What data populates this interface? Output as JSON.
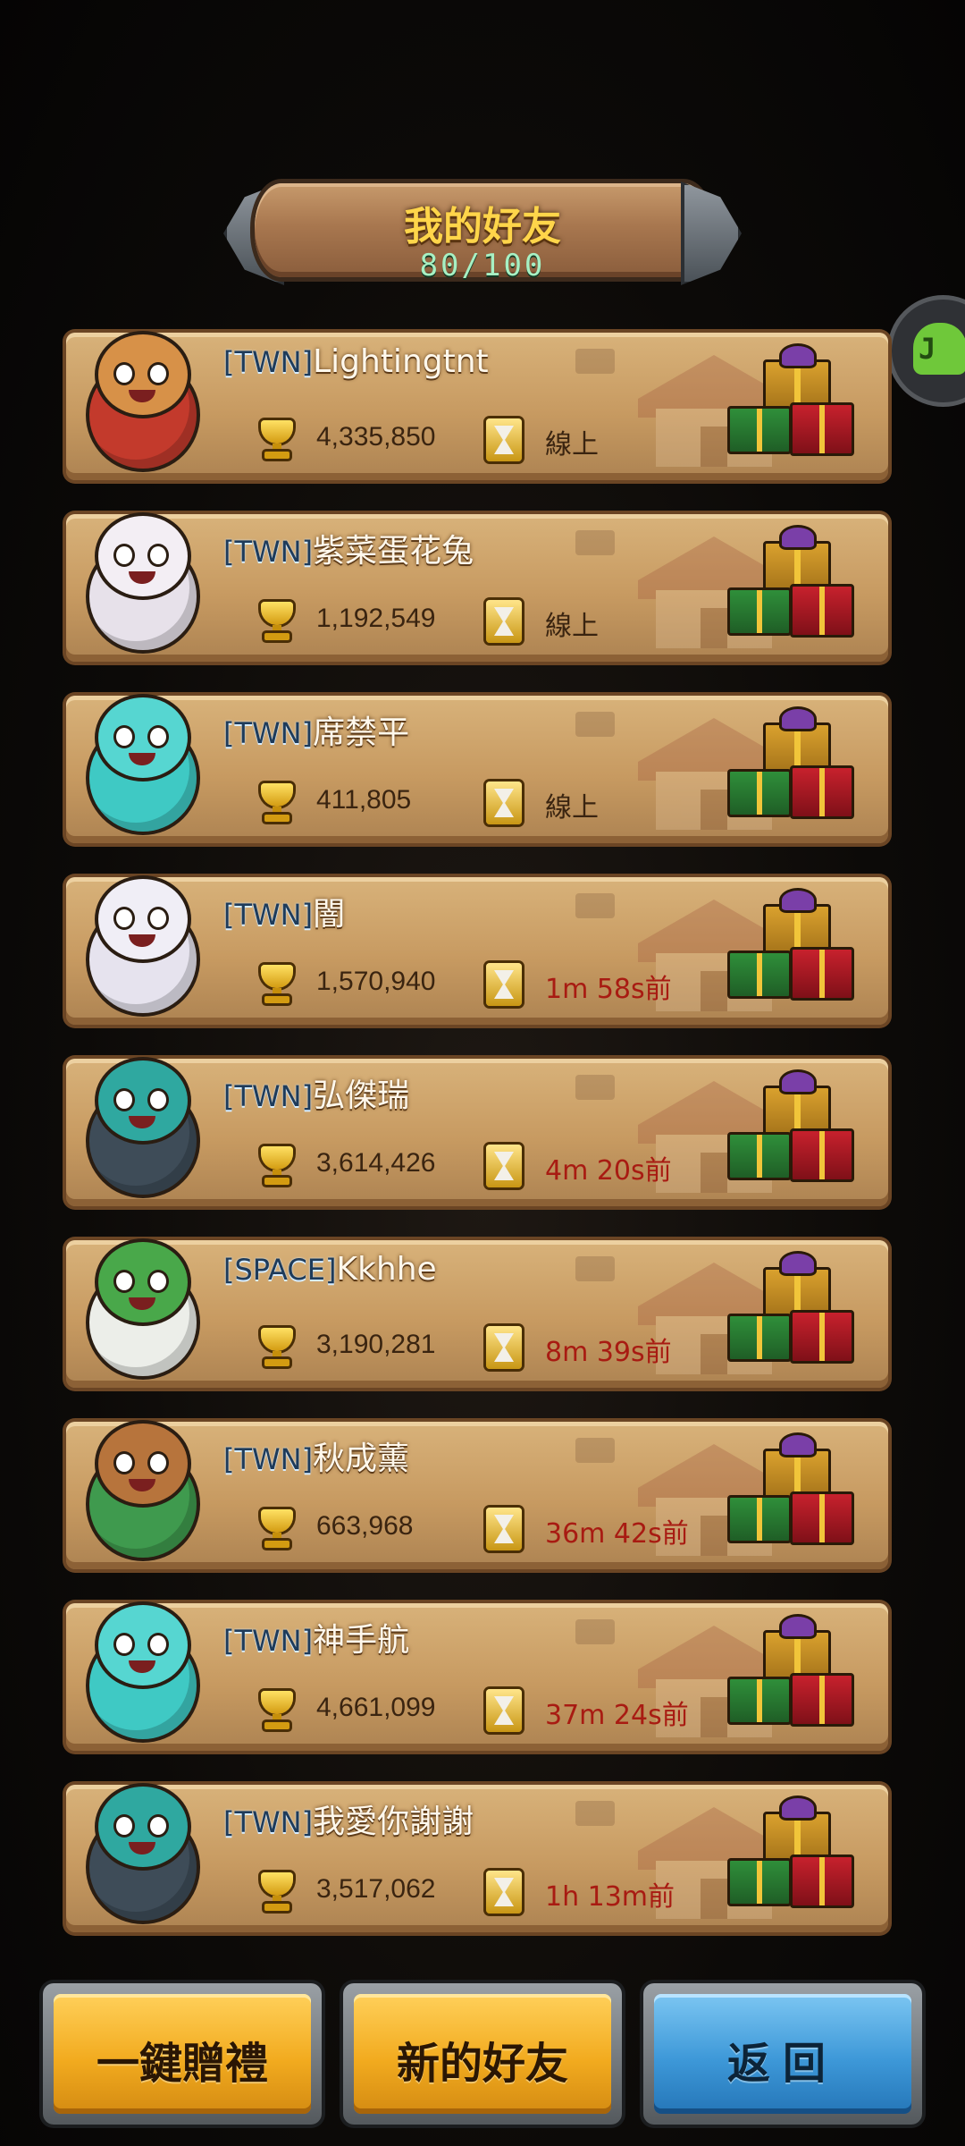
{
  "header": {
    "title": "我的好友",
    "count": "80/100"
  },
  "friends": [
    {
      "tag": "[TWN]",
      "name": "Lightingtnt",
      "score": "4,335,850",
      "status": "線上",
      "online": true,
      "avatar_color": "#c33a2c",
      "head_color": "#d79148"
    },
    {
      "tag": "[TWN]",
      "name": "紫菜蛋花兔",
      "score": "1,192,549",
      "status": "線上",
      "online": true,
      "avatar_color": "#e7e1ea",
      "head_color": "#f3eef4"
    },
    {
      "tag": "[TWN]",
      "name": "席禁平",
      "score": "411,805",
      "status": "線上",
      "online": true,
      "avatar_color": "#3fc9c4",
      "head_color": "#56d6d1"
    },
    {
      "tag": "[TWN]",
      "name": "闇",
      "score": "1,570,940",
      "status": "1m 58s前",
      "online": false,
      "avatar_color": "#e6e3ee",
      "head_color": "#f0eef6"
    },
    {
      "tag": "[TWN]",
      "name": "弘傑瑞",
      "score": "3,614,426",
      "status": "4m 20s前",
      "online": false,
      "avatar_color": "#3e4c58",
      "head_color": "#2fa8a0"
    },
    {
      "tag": "[SPACE]",
      "name": "Kkhhe",
      "score": "3,190,281",
      "status": "8m 39s前",
      "online": false,
      "avatar_color": "#eceee9",
      "head_color": "#49a84a"
    },
    {
      "tag": "[TWN]",
      "name": "秋成薰",
      "score": "663,968",
      "status": "36m 42s前",
      "online": false,
      "avatar_color": "#3f9a4e",
      "head_color": "#b7743c"
    },
    {
      "tag": "[TWN]",
      "name": "神手航",
      "score": "4,661,099",
      "status": "37m 24s前",
      "online": false,
      "avatar_color": "#3fc9c4",
      "head_color": "#56d6d1"
    },
    {
      "tag": "[TWN]",
      "name": "我愛你謝謝",
      "score": "3,517,062",
      "status": "1h 13m前",
      "online": false,
      "avatar_color": "#3e4c58",
      "head_color": "#2fa8a0"
    }
  ],
  "buttons": {
    "send_all": "一鍵贈禮",
    "new_friends": "新的好友",
    "back": "返回"
  },
  "icons": {
    "trophy": "trophy-icon",
    "hourglass": "hourglass-icon",
    "gift": "gift-icon",
    "android": "android-icon"
  }
}
